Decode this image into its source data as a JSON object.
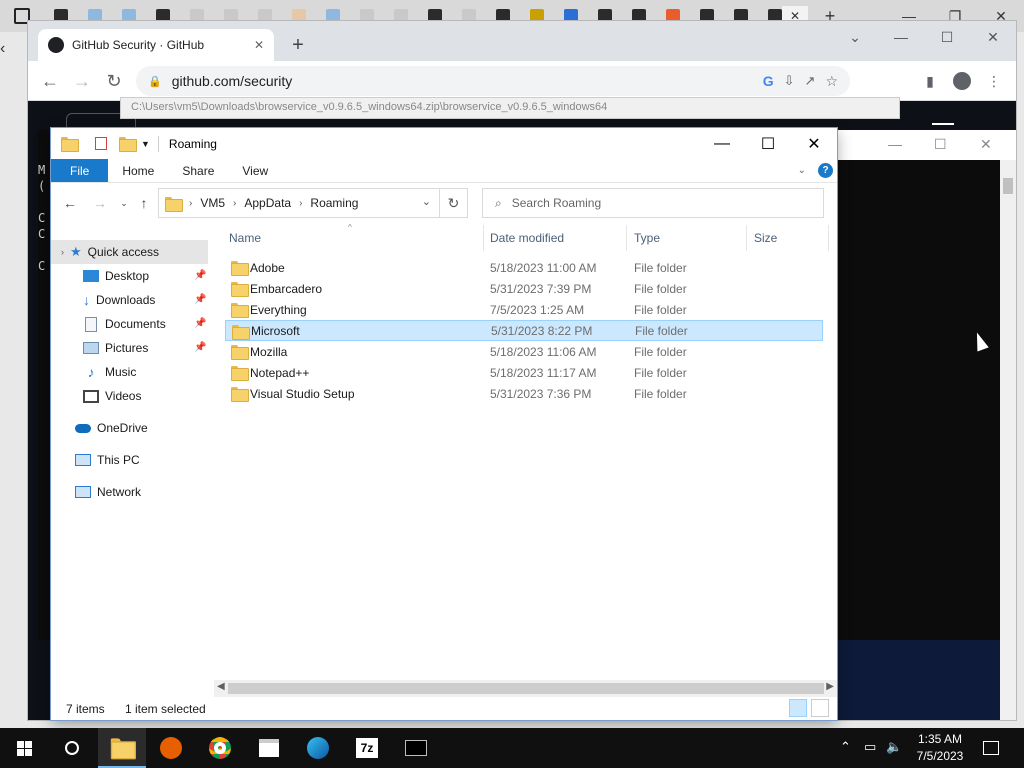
{
  "edge": {
    "tab_favicons": [
      "#2b2b2b",
      "#8fb8de",
      "#8fb8de",
      "#2b2b2b",
      "#c9c9c9",
      "#c9c9c9",
      "#c9c9c9",
      "#e6c8a8",
      "#8fb8de",
      "#c9c9c9",
      "#c9c9c9",
      "#2b2b2b",
      "#c9c9c9",
      "#2b2b2b",
      "#c8a000",
      "#2b6fd6",
      "#2b2b2b",
      "#2b2b2b",
      "#e95d2c",
      "#2b2b2b",
      "#2b2b2b",
      "#2b2b2b"
    ]
  },
  "chrome": {
    "tab_title": "GitHub Security · GitHub",
    "url": "github.com/security"
  },
  "console": {
    "path": "C:\\Users\\vm5\\Downloads\\browservice_v0.9.6.5_windows64.zip\\browservice_v0.9.6.5_windows64",
    "lines": [
      "M",
      "(",
      "",
      "C",
      "C",
      "",
      "C"
    ]
  },
  "explorer": {
    "title": "Roaming",
    "ribbon": {
      "file": "File",
      "home": "Home",
      "share": "Share",
      "view": "View"
    },
    "breadcrumb": [
      "VM5",
      "AppData",
      "Roaming"
    ],
    "search_placeholder": "Search Roaming",
    "nav": {
      "quick_access": "Quick access",
      "desktop": "Desktop",
      "downloads": "Downloads",
      "documents": "Documents",
      "pictures": "Pictures",
      "music": "Music",
      "videos": "Videos",
      "onedrive": "OneDrive",
      "thispc": "This PC",
      "network": "Network"
    },
    "columns": {
      "name": "Name",
      "date": "Date modified",
      "type": "Type",
      "size": "Size"
    },
    "files": [
      {
        "name": "Adobe",
        "date": "5/18/2023 11:00 AM",
        "type": "File folder"
      },
      {
        "name": "Embarcadero",
        "date": "5/31/2023 7:39 PM",
        "type": "File folder"
      },
      {
        "name": "Everything",
        "date": "7/5/2023 1:25 AM",
        "type": "File folder"
      },
      {
        "name": "Microsoft",
        "date": "5/31/2023 8:22 PM",
        "type": "File folder"
      },
      {
        "name": "Mozilla",
        "date": "5/18/2023 11:06 AM",
        "type": "File folder"
      },
      {
        "name": "Notepad++",
        "date": "5/18/2023 11:17 AM",
        "type": "File folder"
      },
      {
        "name": "Visual Studio Setup",
        "date": "5/31/2023 7:36 PM",
        "type": "File folder"
      }
    ],
    "selected_index": 3,
    "status": {
      "items": "7 items",
      "selected": "1 item selected"
    }
  },
  "taskbar": {
    "time": "1:35 AM",
    "date": "7/5/2023"
  }
}
